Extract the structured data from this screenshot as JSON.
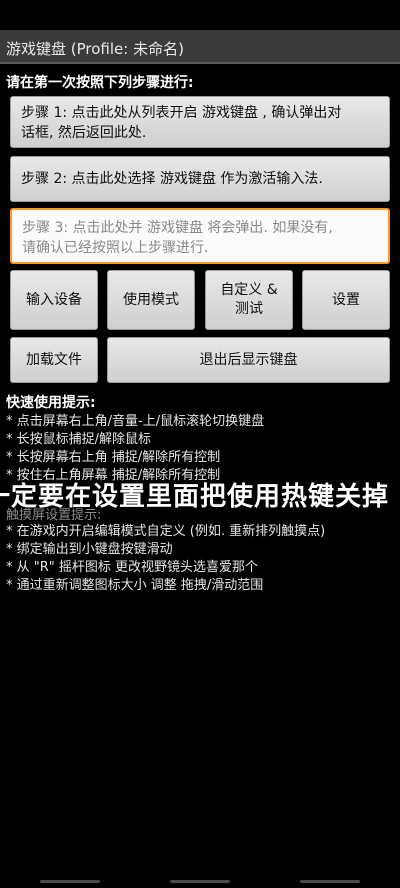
{
  "title_bar": {
    "title": "游戏键盘 (Profile: 未命名)"
  },
  "instructions_header": "请在第一次按照下列步骤进行:",
  "steps": [
    {
      "line1": "步骤 1: 点击此处从列表开启 游戏键盘 , 确认弹出对",
      "line2": "话框, 然后返回此处."
    },
    {
      "line1": "步骤 2: 点击此处选择 游戏键盘 作为激活输入法."
    },
    {
      "line1": "步骤 3: 点击此处并 游戏键盘 将会弹出. 如果没有,",
      "line2": "请确认已经按照以上步骤进行."
    }
  ],
  "buttons": {
    "input_device": "输入设备",
    "usage_mode": "使用模式",
    "customize_line1": "自定义 &",
    "customize_line2": "测试",
    "settings": "设置",
    "load_file": "加载文件",
    "exit_show_keyboard": "退出后显示键盘"
  },
  "quick_tips": {
    "title": "快速使用提示:",
    "items": [
      "* 点击屏幕右上角/音量-上/鼠标滚轮切换键盘",
      "* 长按鼠标捕捉/解除鼠标",
      "* 长按屏幕右上角 捕捉/解除所有控制",
      "* 按住右上角屏幕 捕捉/解除所有控制"
    ]
  },
  "overlay_caption": "一定要在设置里面把使用热键关掉",
  "obscured_header": "触摸屏设置提示:",
  "touch_tips": {
    "items": [
      "* 在游戏内开启编辑模式自定义 (例如. 重新排列触摸点)",
      "* 绑定输出到小键盘按键滑动",
      "* 从 \"R\" 摇杆图标 更改视野镜头选喜爱那个",
      "* 通过重新调整图标大小 调整 拖拽/滑动范围"
    ]
  },
  "colors": {
    "title_bar": "#3b3b3b",
    "button": "#dcdcdc",
    "highlight_border": "#ff9a1f",
    "background": "#000000"
  }
}
